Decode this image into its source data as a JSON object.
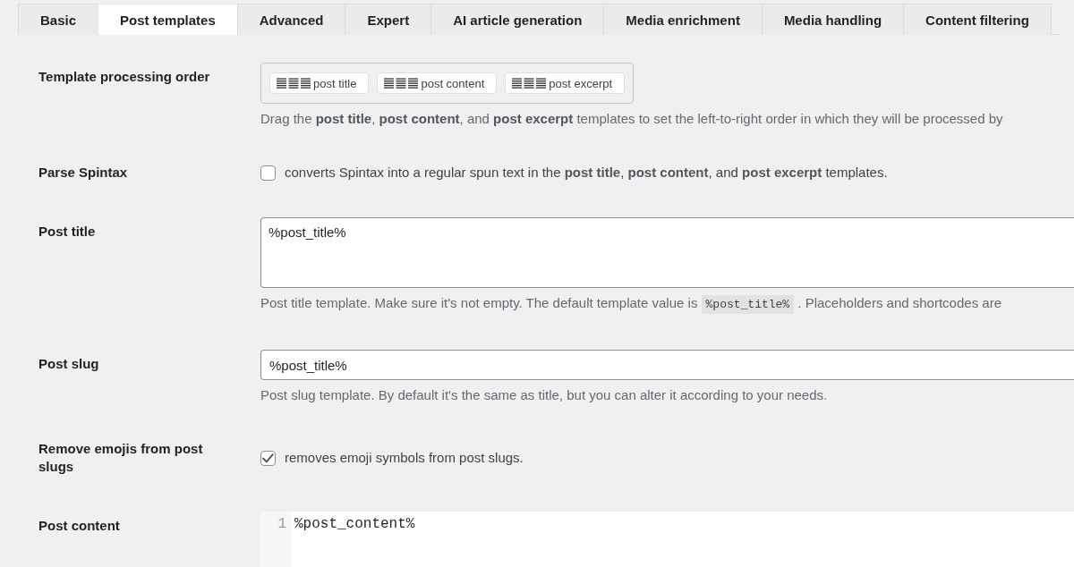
{
  "tabs": [
    {
      "label": "Basic",
      "selected": false
    },
    {
      "label": "Post templates",
      "selected": true
    },
    {
      "label": "Advanced",
      "selected": false
    },
    {
      "label": "Expert",
      "selected": false
    },
    {
      "label": "AI article generation",
      "selected": false
    },
    {
      "label": "Media enrichment",
      "selected": false
    },
    {
      "label": "Media handling",
      "selected": false
    },
    {
      "label": "Content filtering",
      "selected": false
    }
  ],
  "settings": [
    {
      "kind": "sortable",
      "label": "Template processing order",
      "items": [
        "post title",
        "post content",
        "post excerpt"
      ],
      "description": [
        {
          "kind": "text",
          "text": "Drag the **post title**, **post content**, and **post excerpt** templates to set the left-to-right order in which they will be processed by"
        }
      ]
    },
    {
      "kind": "checkbox",
      "label": "Parse Spintax",
      "checked": false,
      "text": "converts Spintax into a regular spun text in the **post title**, **post content**, and **post excerpt** templates."
    },
    {
      "kind": "textarea",
      "label": "Post title",
      "value": "%post_title%",
      "description": [
        {
          "kind": "text",
          "text": "Post title template. Make sure it's not empty. The default template value is "
        },
        {
          "kind": "code",
          "text": "%post_title%"
        },
        {
          "kind": "text",
          "text": " . Placeholders and shortcodes are"
        }
      ]
    },
    {
      "kind": "input",
      "label": "Post slug",
      "value": "%post_title%",
      "description": [
        {
          "kind": "text",
          "text": "Post slug template. By default it's the same as title, but you can alter it according to your needs."
        }
      ]
    },
    {
      "kind": "checkbox",
      "label": "Remove emojis from post slugs",
      "checked": true,
      "text": "removes emoji symbols from post slugs."
    },
    {
      "kind": "code_editor",
      "label": "Post content",
      "lines": [
        {
          "number": "1",
          "text": "%post_content%"
        }
      ]
    }
  ]
}
